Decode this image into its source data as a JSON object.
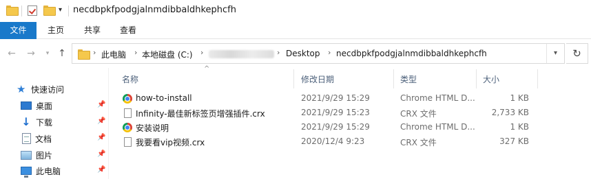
{
  "title_bar": {
    "title": "necdbpkfpodgjalnmdibbaldhkephcfh",
    "icons": [
      "folder-icon",
      "properties-check-icon",
      "new-folder-icon",
      "customize-dropdown-icon"
    ]
  },
  "ribbon": {
    "tabs": [
      "文件",
      "主页",
      "共享",
      "查看"
    ],
    "accent": "#1979ca"
  },
  "address_bar": {
    "crumbs": [
      "此电脑",
      "本地磁盘 (C:)",
      "Desktop",
      "necdbpkfpodgjalnmdibbaldhkephcfh"
    ]
  },
  "nav_pane": {
    "items": [
      {
        "label": "快速访问",
        "icon": "star-icon",
        "pinned": false
      },
      {
        "label": "桌面",
        "icon": "desktop-icon",
        "pinned": true
      },
      {
        "label": "下载",
        "icon": "download-icon",
        "pinned": true
      },
      {
        "label": "文档",
        "icon": "document-icon",
        "pinned": true
      },
      {
        "label": "图片",
        "icon": "pictures-icon",
        "pinned": true
      },
      {
        "label": "此电脑",
        "icon": "computer-icon",
        "pinned": true
      }
    ]
  },
  "file_list": {
    "columns": {
      "name": "名称",
      "date": "修改日期",
      "type": "类型",
      "size": "大小"
    },
    "rows": [
      {
        "name": "how-to-install",
        "date": "2021/9/29 15:29",
        "type": "Chrome HTML D...",
        "size": "1 KB",
        "icon": "chrome-html-icon"
      },
      {
        "name": "Infinity-最佳新标签页增强插件.crx",
        "date": "2021/9/29 15:23",
        "type": "CRX 文件",
        "size": "2,733 KB",
        "icon": "crx-file-icon"
      },
      {
        "name": "安装说明",
        "date": "2021/9/29 15:29",
        "type": "Chrome HTML D...",
        "size": "1 KB",
        "icon": "chrome-html-icon"
      },
      {
        "name": "我要看vip视频.crx",
        "date": "2020/12/4 9:23",
        "type": "CRX 文件",
        "size": "327 KB",
        "icon": "crx-file-icon"
      }
    ]
  }
}
